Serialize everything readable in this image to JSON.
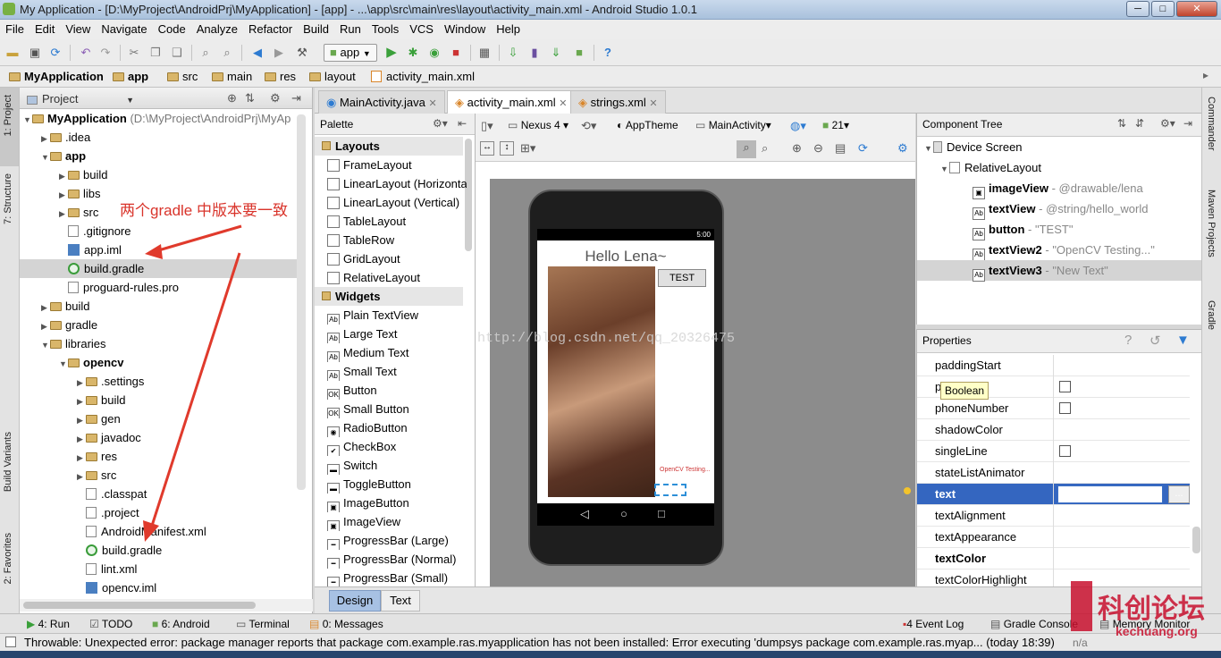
{
  "window": {
    "title": "My Application - [D:\\MyProject\\AndroidPrj\\MyApplication] - [app] - ...\\app\\src\\main\\res\\layout\\activity_main.xml - Android Studio 1.0.1",
    "min": "─",
    "max": "□",
    "close": "✕"
  },
  "menu": [
    "File",
    "Edit",
    "View",
    "Navigate",
    "Code",
    "Analyze",
    "Refactor",
    "Build",
    "Run",
    "Tools",
    "VCS",
    "Window",
    "Help"
  ],
  "toolbar": {
    "run_config": "app"
  },
  "breadcrumb": [
    "MyApplication",
    "app",
    "src",
    "main",
    "res",
    "layout",
    "activity_main.xml"
  ],
  "left_strip": {
    "project": "1: Project",
    "structure": "7: Structure",
    "build_variants": "Build Variants",
    "favorites": "2: Favorites"
  },
  "right_strip": {
    "commander": "Commander",
    "maven": "Maven Projects",
    "gradle": "Gradle"
  },
  "project_panel": {
    "title": "Project",
    "root_name": "MyApplication",
    "root_path": "(D:\\MyProject\\AndroidPrj\\MyAp",
    "items": [
      {
        "label": ".idea",
        "kind": "folder"
      },
      {
        "label": "app",
        "kind": "folder-bold"
      },
      {
        "label": "build",
        "kind": "folder"
      },
      {
        "label": "libs",
        "kind": "folder"
      },
      {
        "label": "src",
        "kind": "folder"
      },
      {
        "label": ".gitignore",
        "kind": "file"
      },
      {
        "label": "app.iml",
        "kind": "iml"
      },
      {
        "label": "build.gradle",
        "kind": "gradle"
      },
      {
        "label": "proguard-rules.pro",
        "kind": "file"
      },
      {
        "label": "build",
        "kind": "folder"
      },
      {
        "label": "gradle",
        "kind": "folder"
      },
      {
        "label": "libraries",
        "kind": "folder"
      },
      {
        "label": "opencv",
        "kind": "folder-bold"
      },
      {
        "label": ".settings",
        "kind": "folder"
      },
      {
        "label": "build",
        "kind": "folder"
      },
      {
        "label": "gen",
        "kind": "folder"
      },
      {
        "label": "javadoc",
        "kind": "folder"
      },
      {
        "label": "res",
        "kind": "folder"
      },
      {
        "label": "src",
        "kind": "folder"
      },
      {
        "label": ".classpat",
        "kind": "file"
      },
      {
        "label": ".project",
        "kind": "file"
      },
      {
        "label": "AndroidManifest.xml",
        "kind": "file"
      },
      {
        "label": "build.gradle",
        "kind": "gradle"
      },
      {
        "label": "lint.xml",
        "kind": "file"
      },
      {
        "label": "opencv.iml",
        "kind": "iml"
      }
    ],
    "annotation": "两个gradle 中版本要一致"
  },
  "editor_tabs": [
    {
      "label": "MainActivity.java"
    },
    {
      "label": "activity_main.xml"
    },
    {
      "label": "strings.xml"
    }
  ],
  "palette": {
    "title": "Palette",
    "cat_layouts": "Layouts",
    "layouts": [
      "FrameLayout",
      "LinearLayout (Horizonta",
      "LinearLayout (Vertical)",
      "TableLayout",
      "TableRow",
      "GridLayout",
      "RelativeLayout"
    ],
    "cat_widgets": "Widgets",
    "widgets": [
      "Plain TextView",
      "Large Text",
      "Medium Text",
      "Small Text",
      "Button",
      "Small Button",
      "RadioButton",
      "CheckBox",
      "Switch",
      "ToggleButton",
      "ImageButton",
      "ImageView",
      "ProgressBar (Large)",
      "ProgressBar (Normal)",
      "ProgressBar (Small)"
    ]
  },
  "design_toolbar": {
    "device": "Nexus 4",
    "theme": "AppTheme",
    "activity": "MainActivity",
    "api": "21"
  },
  "preview": {
    "time": "5:00",
    "hello": "Hello Lena~",
    "button": "TEST",
    "tv2": "OpenCV Testing...",
    "watermark": "http://blog.csdn.net/qq_20326475"
  },
  "component_tree": {
    "title": "Component Tree",
    "device": "Device Screen",
    "layout": "RelativeLayout",
    "items": [
      {
        "name": "imageView",
        "value": "- @drawable/lena"
      },
      {
        "name": "textView",
        "value": "- @string/hello_world"
      },
      {
        "name": "button",
        "value": "- \"TEST\""
      },
      {
        "name": "textView2",
        "value": "- \"OpenCV Testing...\""
      },
      {
        "name": "textView3",
        "value": "- \"New Text\""
      }
    ]
  },
  "properties": {
    "title": "Properties",
    "tooltip": "Boolean",
    "rows": [
      {
        "name": "paddingStart",
        "type": "empty"
      },
      {
        "name": "p",
        "type": "check"
      },
      {
        "name": "phoneNumber",
        "type": "check"
      },
      {
        "name": "shadowColor",
        "type": "empty"
      },
      {
        "name": "singleLine",
        "type": "check"
      },
      {
        "name": "stateListAnimator",
        "type": "empty"
      },
      {
        "name": "text",
        "type": "input"
      },
      {
        "name": "textAlignment",
        "type": "empty"
      },
      {
        "name": "textAppearance",
        "type": "empty"
      },
      {
        "name": "textColor",
        "type": "empty"
      },
      {
        "name": "textColorHighlight",
        "type": "empty"
      }
    ],
    "ellipsis": "..."
  },
  "design_tabs": {
    "design": "Design",
    "text": "Text"
  },
  "tool_windows": {
    "run": "4: Run",
    "todo": "TODO",
    "android": "6: Android",
    "terminal": "Terminal",
    "messages": "0: Messages",
    "event_log": "4 Event Log",
    "gradle_console": "Gradle Console",
    "memory_monitor": "Memory Monitor"
  },
  "status": {
    "message": "Throwable: Unexpected error: package manager reports that package com.example.ras.myapplication has not been installed: Error executing 'dumpsys package com.example.ras.myap... (today 18:39)",
    "position": "n/a",
    "brand": "科创论坛",
    "brand_url": "kechuang.org"
  }
}
